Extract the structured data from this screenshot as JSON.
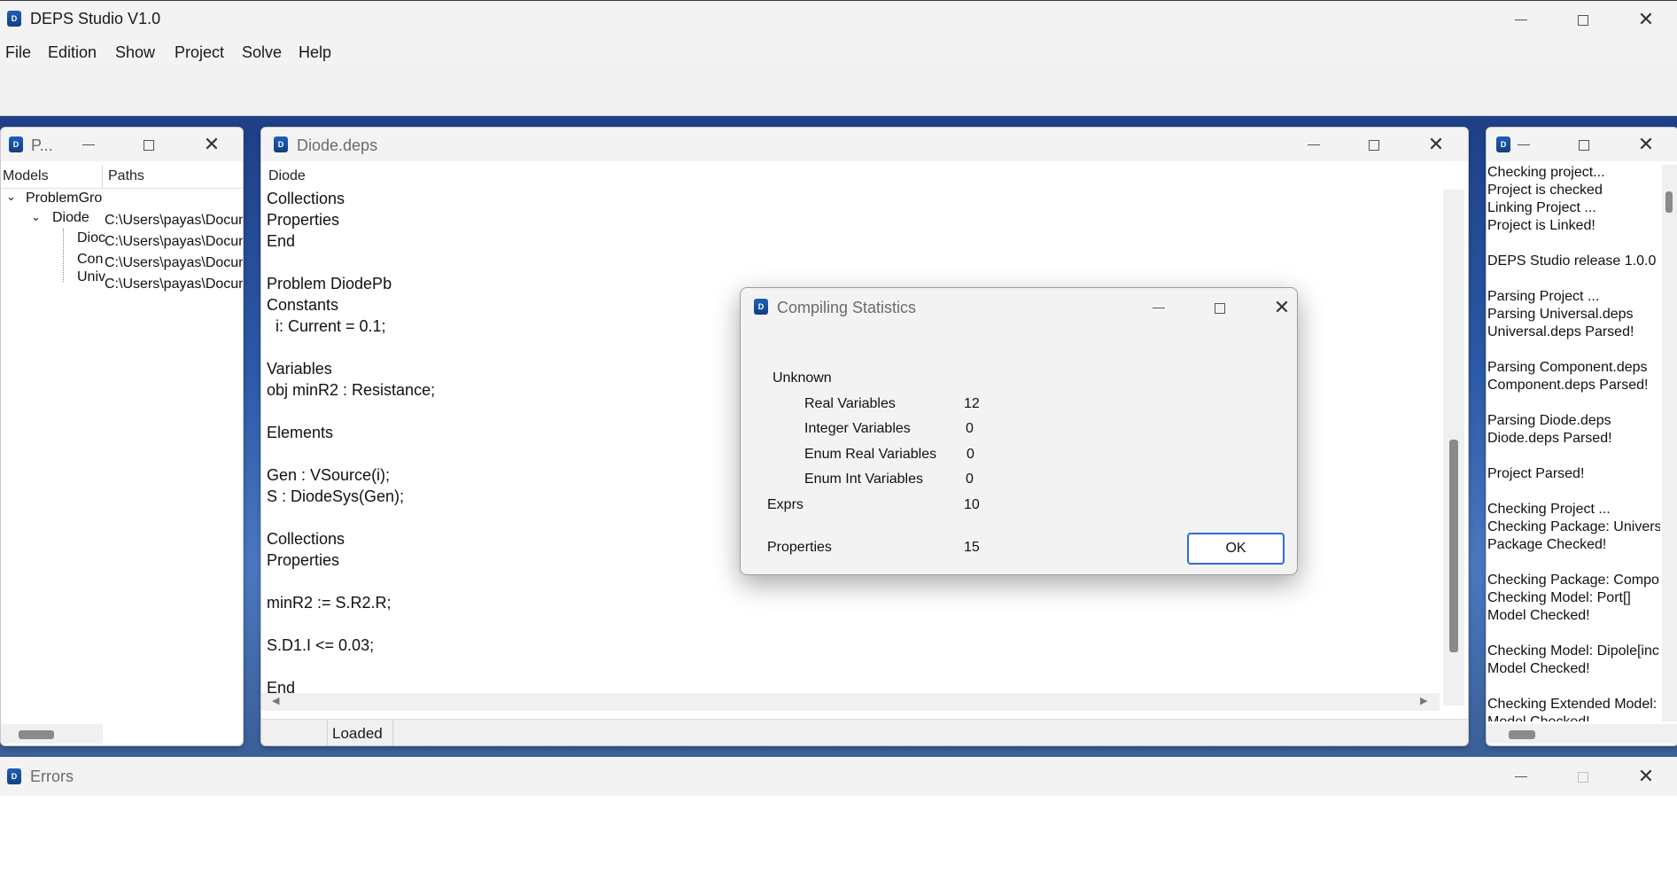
{
  "app": {
    "title": "DEPS Studio V1.0",
    "icon": "deps-logo-icon"
  },
  "menu": [
    "File",
    "Edition",
    "Show",
    "Project",
    "Solve",
    "Help"
  ],
  "project_panel": {
    "title": "P...",
    "columns": [
      "Models",
      "Paths"
    ],
    "tree": [
      {
        "label": "ProblemGro",
        "path": ""
      },
      {
        "label": "Diode",
        "path": "C:\\Users\\payas\\Docun"
      },
      {
        "label": "Dioc",
        "path": "C:\\Users\\payas\\Docun"
      },
      {
        "label": "Con",
        "path": "C:\\Users\\payas\\Docun"
      },
      {
        "label": "Univ",
        "path": "C:\\Users\\payas\\Docun"
      }
    ]
  },
  "editor": {
    "title": "Diode.deps",
    "tab": "Diode",
    "status": "Loaded",
    "lines": [
      "Collections",
      "Properties",
      "End",
      "",
      "Problem DiodePb",
      "Constants",
      "  i: Current = 0.1;",
      "",
      "Variables",
      "obj minR2 : Resistance;",
      "",
      "Elements",
      "",
      "Gen : VSource(i);",
      "S : DiodeSys(Gen);",
      "",
      "Collections",
      "Properties",
      "",
      "minR2 := S.R2.R;",
      "",
      "S.D1.I <= 0.03;",
      "",
      "End"
    ]
  },
  "log_panel": {
    "lines": [
      "Checking project...",
      "Project is checked",
      "Linking Project ...",
      "Project is Linked!",
      "",
      "DEPS Studio release 1.0.0",
      "",
      "Parsing Project ...",
      "Parsing Universal.deps",
      "Universal.deps Parsed!",
      "",
      "Parsing Component.deps",
      "Component.deps Parsed!",
      "",
      "Parsing Diode.deps",
      "Diode.deps Parsed!",
      "",
      "Project Parsed!",
      "",
      "Checking Project ...",
      "Checking Package: Univers",
      "Package Checked!",
      "",
      "Checking Package: Compo",
      "Checking Model: Port[]",
      "Model Checked!",
      "",
      "Checking Model: Dipole[inc",
      "Model Checked!",
      "",
      "Checking Extended Model:",
      "Model Checked!"
    ]
  },
  "dialog": {
    "title": "Compiling Statistics",
    "section": "Unknown",
    "rows": [
      {
        "label": "Real Variables",
        "value": "12"
      },
      {
        "label": "Integer Variables",
        "value": "0"
      },
      {
        "label": "Enum Real Variables",
        "value": "0"
      },
      {
        "label": "Enum Int Variables",
        "value": "0"
      }
    ],
    "exprs": {
      "label": "Exprs",
      "value": "10"
    },
    "properties": {
      "label": "Properties",
      "value": "15"
    },
    "ok_label": "OK"
  },
  "errors_panel": {
    "title": "Errors"
  },
  "colors": {
    "accent": "#2a6fd6",
    "wallpaper": "#2b5aa8",
    "chrome": "#f3f3f3"
  }
}
